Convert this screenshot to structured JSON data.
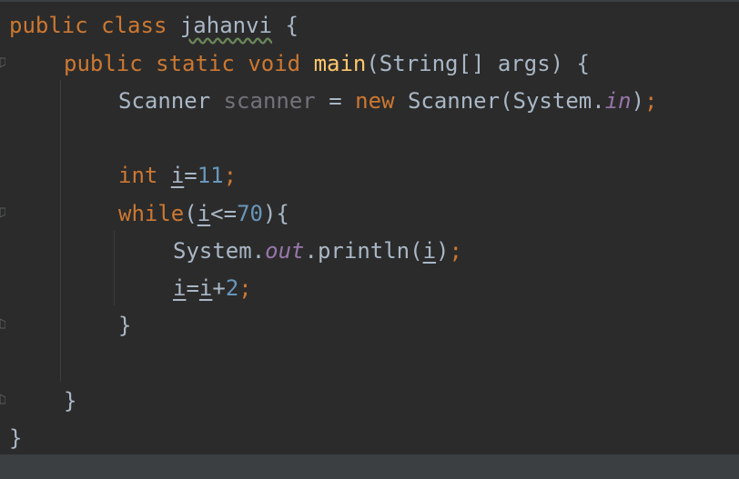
{
  "code": {
    "line1": {
      "kw_public": "public",
      "kw_class": "class",
      "class_name": "jahanvi",
      "brace": "{"
    },
    "line2": {
      "kw_public": "public",
      "kw_static": "static",
      "kw_void": "void",
      "method": "main",
      "params": "(String[] args) {"
    },
    "line3": {
      "type": "Scanner",
      "var": "scanner",
      "eq": " = ",
      "kw_new": "new",
      "ctor": "Scanner(System.",
      "field": "in",
      "close": ")",
      "semi": ";"
    },
    "line5": {
      "kw_int": "int",
      "var": "i",
      "eq": "=",
      "num": "11",
      "semi": ";"
    },
    "line6": {
      "kw_while": "while",
      "open": "(",
      "var": "i",
      "op": "<=",
      "num": "70",
      "close": "){"
    },
    "line7": {
      "sys": "System.",
      "field": "out",
      "call": ".println(",
      "var": "i",
      "close": ")",
      "semi": ";"
    },
    "line8": {
      "var1": "i",
      "eq": "=",
      "var2": "i",
      "plus": "+",
      "num": "2",
      "semi": ";"
    },
    "line9": {
      "brace": "}"
    },
    "line11": {
      "brace": "}"
    },
    "line12": {
      "brace": "}"
    }
  },
  "colors": {
    "background": "#2b2b2b",
    "keyword": "#cc7832",
    "method": "#ffc66d",
    "number": "#6897bb",
    "field": "#9876aa",
    "text": "#a9b7c6",
    "unused": "#72737a"
  },
  "icons": [
    "fold-icon"
  ]
}
